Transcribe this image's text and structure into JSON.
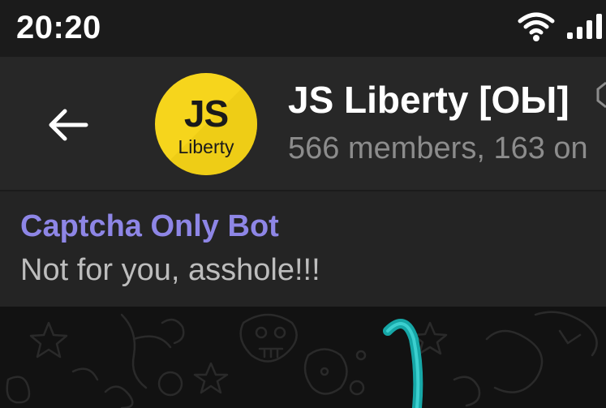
{
  "status_bar": {
    "time": "20:20",
    "icons": [
      "wifi-icon",
      "signal-icon"
    ]
  },
  "header": {
    "back_icon": "arrow-left-icon",
    "avatar": {
      "initials": "JS",
      "subtitle": "Liberty",
      "background": "#f6d51c"
    },
    "title": "JS Liberty [ОЫ]",
    "subtitle": "566 members, 163 on"
  },
  "pinned_message": {
    "sender": "Captcha Only Bot",
    "text": "Not for you, asshole!!!",
    "sender_color": "#8e86e6"
  },
  "chat_background": {
    "pattern": "doodle-pattern",
    "accent_color": "#34c8c8"
  }
}
